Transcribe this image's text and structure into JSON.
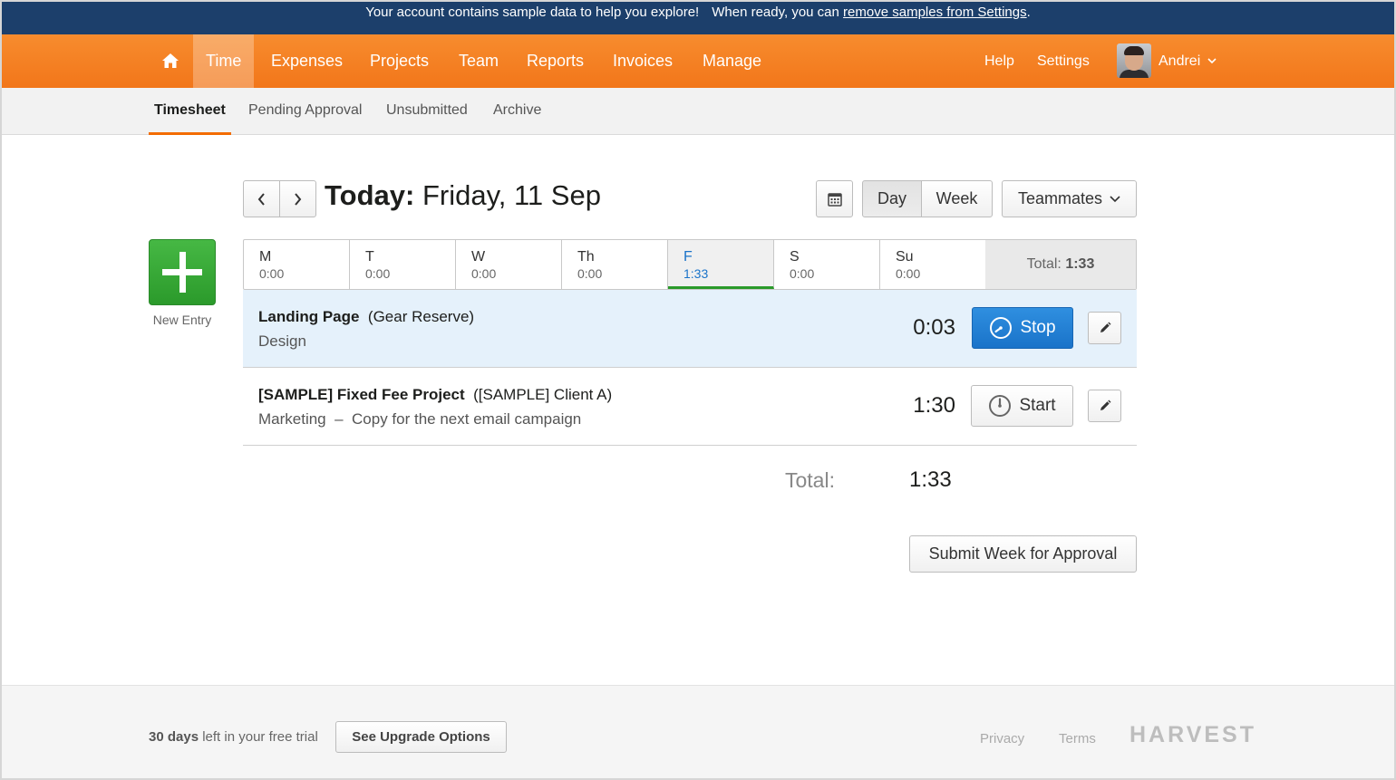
{
  "banner": {
    "message": "Your account contains sample data to help you explore!",
    "prefix": "When ready, you can",
    "link": "remove samples from Settings",
    "suffix": "."
  },
  "nav": {
    "items": [
      "Time",
      "Expenses",
      "Projects",
      "Team",
      "Reports",
      "Invoices",
      "Manage"
    ],
    "help": "Help",
    "settings": "Settings",
    "user": "Andrei",
    "accent": "#f36c00"
  },
  "subnav": {
    "items": [
      "Timesheet",
      "Pending Approval",
      "Unsubmitted",
      "Archive"
    ]
  },
  "header": {
    "today_label": "Today:",
    "date": "Friday, 11 Sep",
    "view_day": "Day",
    "view_week": "Week",
    "teammates": "Teammates"
  },
  "new_entry": {
    "label": "New Entry"
  },
  "week": {
    "days": [
      {
        "name": "M",
        "time": "0:00"
      },
      {
        "name": "T",
        "time": "0:00"
      },
      {
        "name": "W",
        "time": "0:00"
      },
      {
        "name": "Th",
        "time": "0:00"
      },
      {
        "name": "F",
        "time": "1:33"
      },
      {
        "name": "S",
        "time": "0:00"
      },
      {
        "name": "Su",
        "time": "0:00"
      }
    ],
    "total_label": "Total:",
    "total_value": "1:33"
  },
  "entries": [
    {
      "project": "Landing Page",
      "client": "(Gear Reserve)",
      "task": "Design",
      "notes": "",
      "time": "0:03",
      "action": "Stop"
    },
    {
      "project": "[SAMPLE] Fixed Fee Project",
      "client": "([SAMPLE] Client A)",
      "task": "Marketing",
      "dash": "–",
      "notes": "Copy for the next email campaign",
      "time": "1:30",
      "action": "Start"
    }
  ],
  "totals": {
    "label": "Total:",
    "value": "1:33"
  },
  "submit_label": "Submit Week for Approval",
  "footer": {
    "trial_days": "30 days",
    "trial_text": "left in your free trial",
    "upgrade": "See Upgrade Options",
    "privacy": "Privacy",
    "terms": "Terms",
    "logo": "HARVEST"
  }
}
